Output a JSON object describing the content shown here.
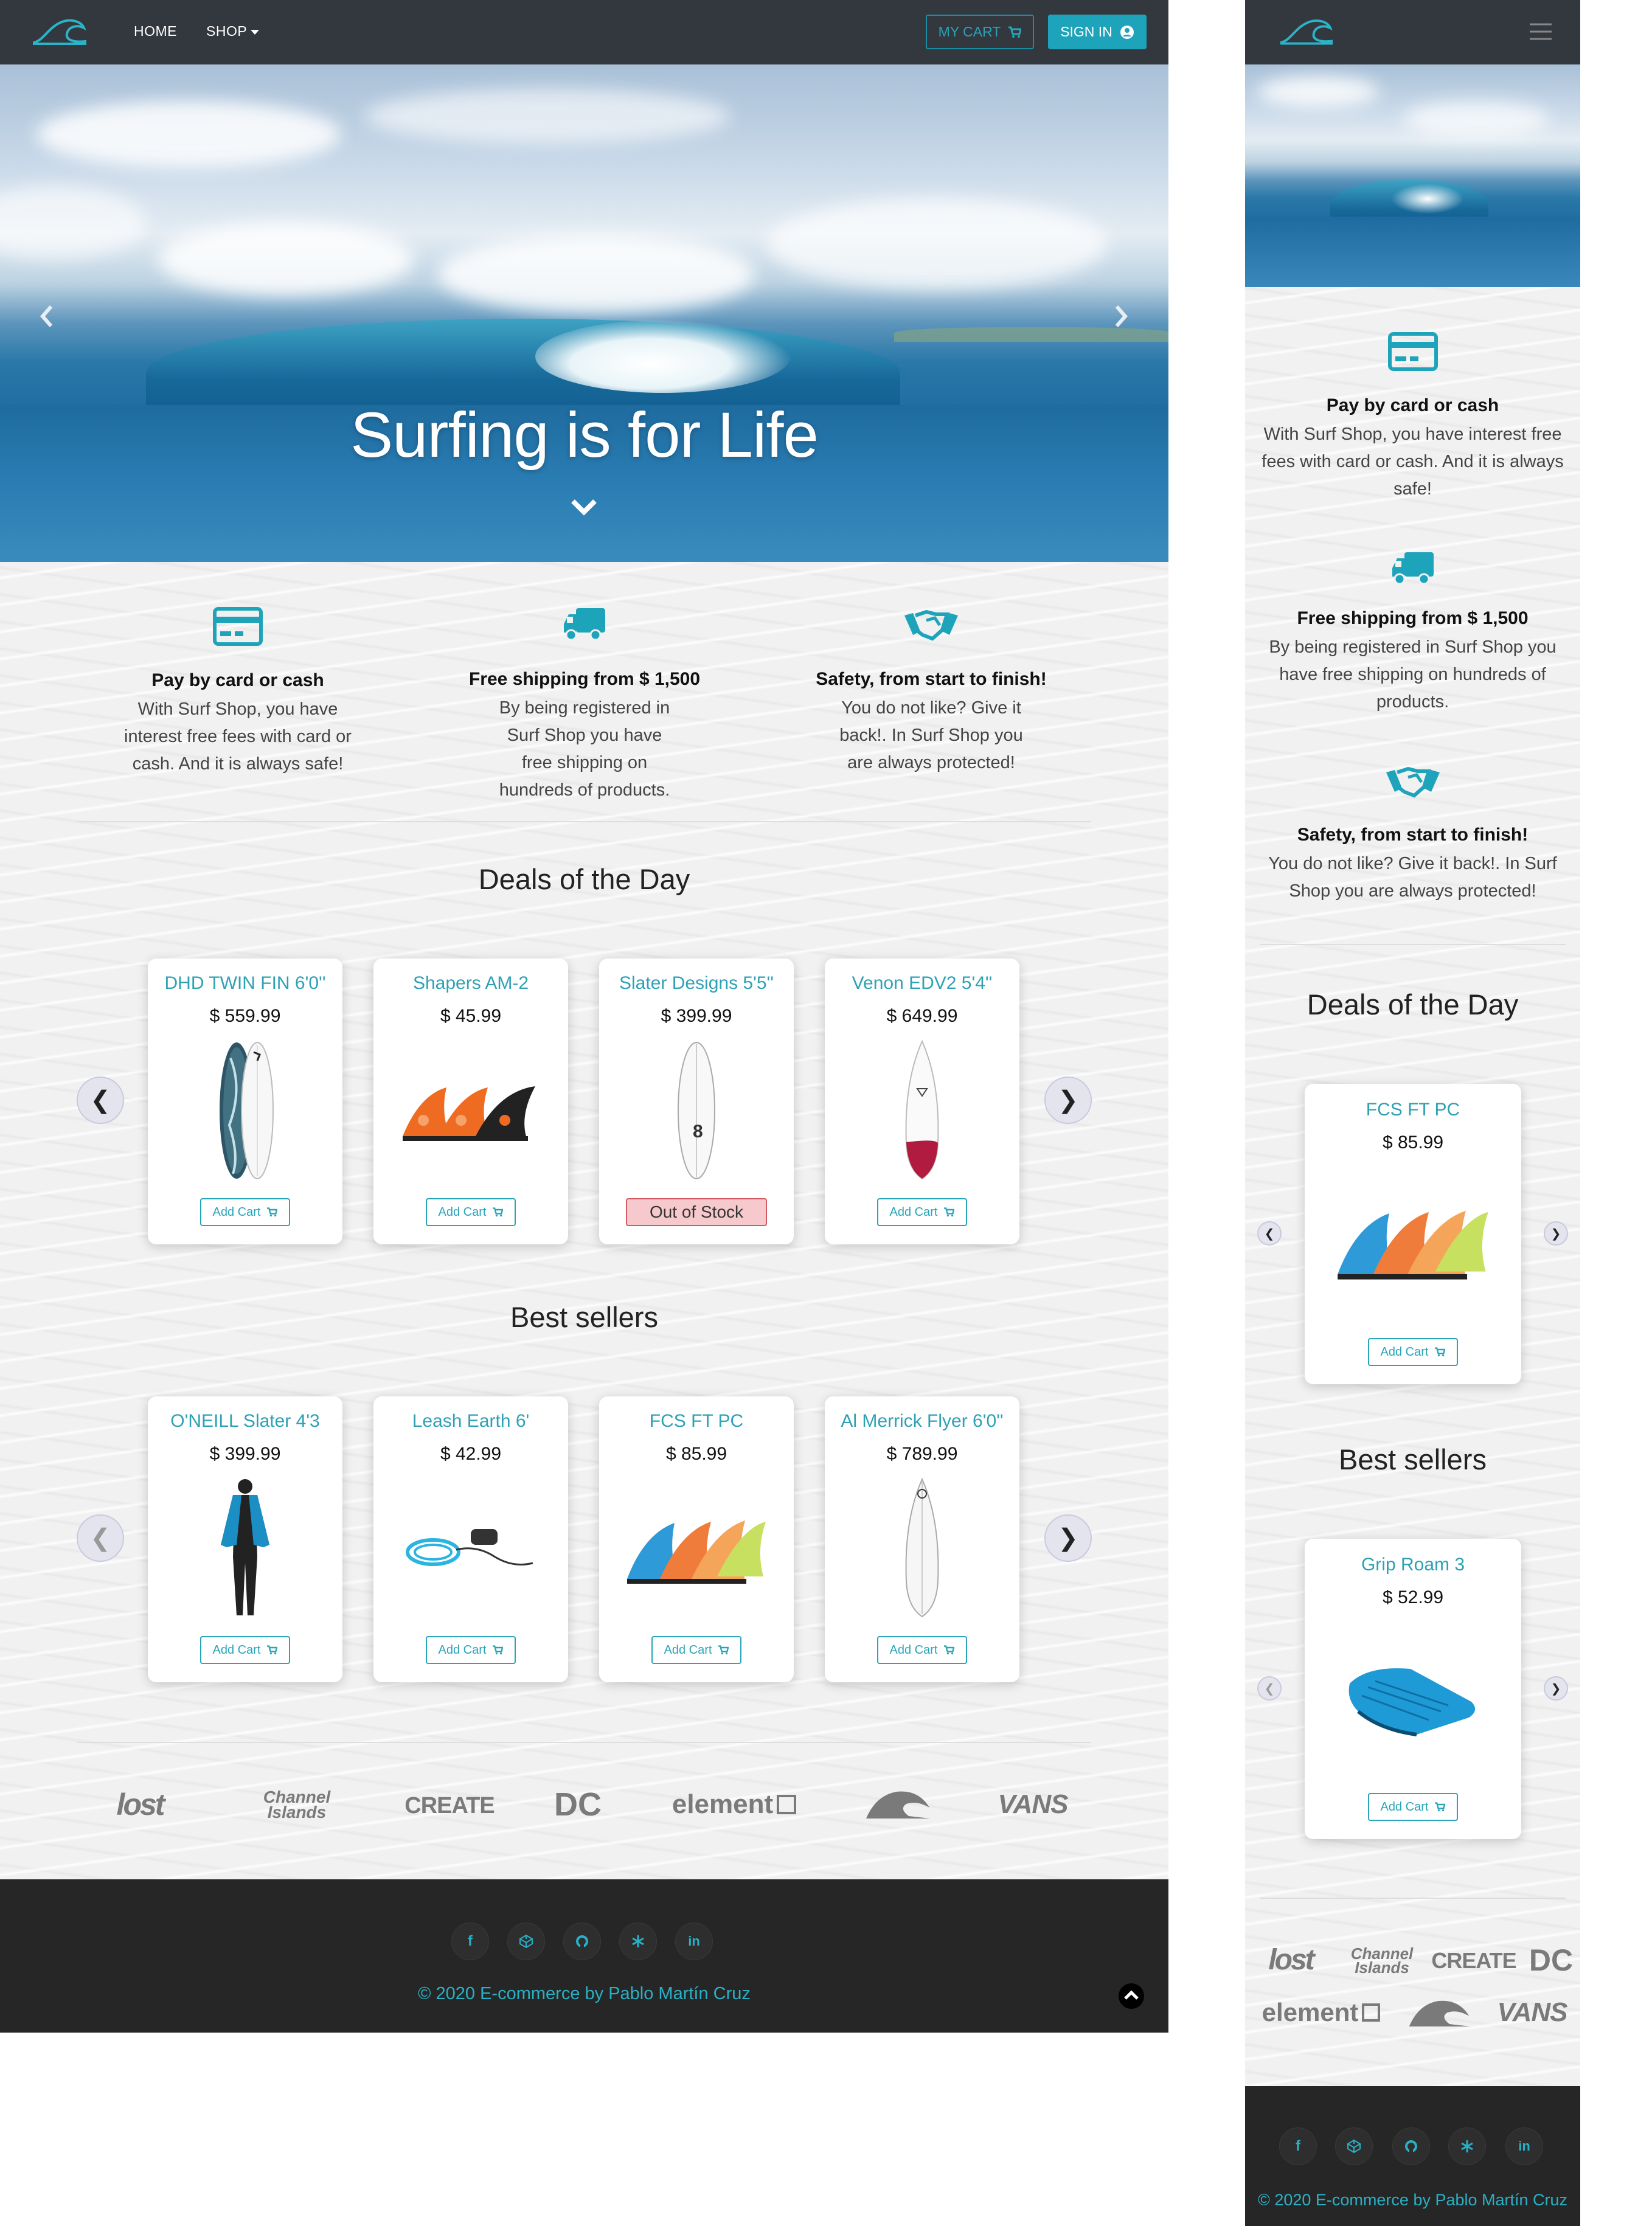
{
  "colors": {
    "accent": "#1ea4ba",
    "nav": "#33373e",
    "footer": "#262626",
    "oos_bg": "#f6c9cc"
  },
  "nav": {
    "home": "HOME",
    "shop": "SHOP",
    "cart": "MY CART",
    "signin": "SIGN IN",
    "logo_icon": "wave-logo-icon",
    "cart_icon": "cart-icon",
    "user_icon": "user-circle-icon",
    "menu_icon": "hamburger-icon"
  },
  "hero": {
    "title": "Surfing is for Life",
    "prev_icon": "chevron-left-icon",
    "next_icon": "chevron-right-icon",
    "down_icon": "chevron-down-icon"
  },
  "features": [
    {
      "icon": "credit-card-icon",
      "title": "Pay by card or cash",
      "text": "With Surf Shop, you have interest free fees with card or cash. And it is always safe!"
    },
    {
      "icon": "truck-icon",
      "title": "Free shipping from $ 1,500",
      "text": "By being registered in Surf Shop you have free shipping on hundreds of products."
    },
    {
      "icon": "handshake-icon",
      "title": "Safety, from start to finish!",
      "text": "You do not like? Give it back!. In Surf Shop you are always protected!"
    }
  ],
  "deals": {
    "title": "Deals of the Day",
    "items": [
      {
        "name": "DHD TWIN FIN 6'0''",
        "price": "$ 559.99",
        "action": "Add Cart",
        "image": "twin-fin-surfboards-image"
      },
      {
        "name": "Shapers AM-2",
        "price": "$ 45.99",
        "action": "Add Cart",
        "image": "orange-fins-image"
      },
      {
        "name": "Slater Designs 5'5''",
        "price": "$ 399.99",
        "action": "Out of Stock",
        "image": "white-surfboard-image"
      },
      {
        "name": "Venon EDV2 5'4''",
        "price": "$ 649.99",
        "action": "Add Cart",
        "image": "red-tail-surfboard-image"
      }
    ]
  },
  "best": {
    "title": "Best sellers",
    "items": [
      {
        "name": "O'NEILL Slater 4'3",
        "price": "$ 399.99",
        "action": "Add Cart",
        "image": "wetsuit-image"
      },
      {
        "name": "Leash Earth 6'",
        "price": "$ 42.99",
        "action": "Add Cart",
        "image": "leash-image"
      },
      {
        "name": "FCS FT PC",
        "price": "$ 85.99",
        "action": "Add Cart",
        "image": "fcs-fins-image"
      },
      {
        "name": "Al Merrick Flyer 6'0''",
        "price": "$ 789.99",
        "action": "Add Cart",
        "image": "white-surfboard-image"
      }
    ]
  },
  "mobile": {
    "deal": {
      "name": "FCS FT PC",
      "price": "$ 85.99",
      "action": "Add Cart"
    },
    "best": {
      "name": "Grip Roam 3",
      "price": "$ 52.99",
      "action": "Add Cart"
    }
  },
  "brands": [
    {
      "name": "Lost",
      "text": "lost"
    },
    {
      "name": "Channel Islands",
      "text": "Channel Islands"
    },
    {
      "name": "Create",
      "text": "CREATE"
    },
    {
      "name": "DC",
      "text": "DC"
    },
    {
      "name": "Element",
      "text": "element"
    },
    {
      "name": "Quiksilver",
      "text": ""
    },
    {
      "name": "Vans",
      "text": "VANS"
    }
  ],
  "footer": {
    "copyright": "© 2020 E-commerce by Pablo Martín Cruz",
    "social": [
      "f",
      "",
      "",
      "",
      ""
    ],
    "social_icons": [
      "facebook-icon",
      "codepen-icon",
      "github-icon",
      "snowflake-icon",
      "linkedin-icon"
    ],
    "top_icon": "scroll-top-icon"
  }
}
